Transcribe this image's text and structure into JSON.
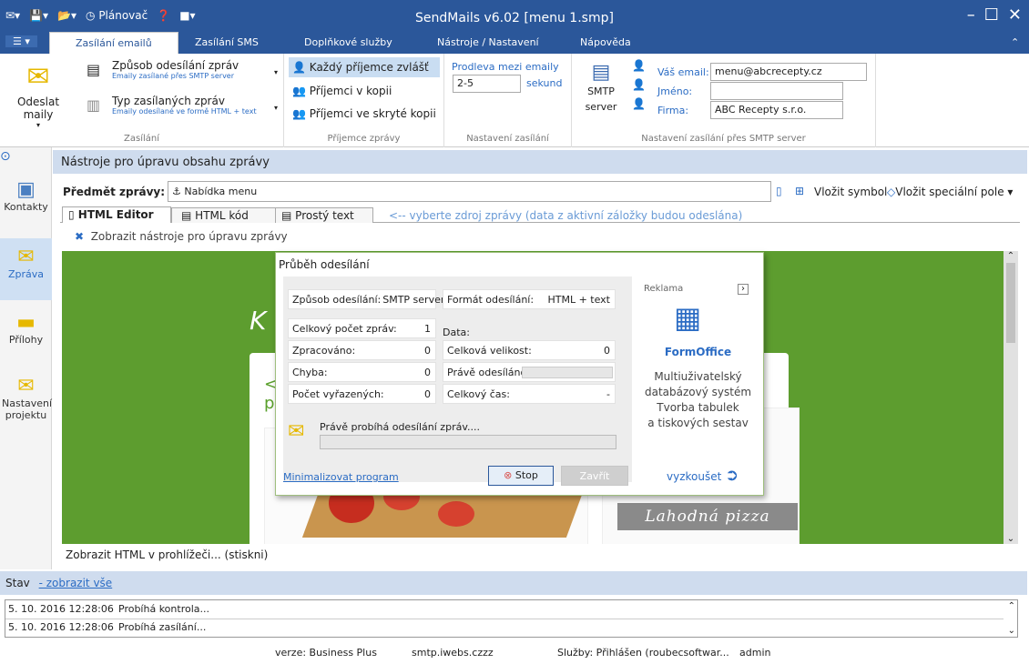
{
  "app": {
    "title": "SendMails v6.02 [menu 1.smp]",
    "qat_scheduler": "Plánovač"
  },
  "tabs": [
    "Zasílání emailů",
    "Zasílání SMS",
    "Doplňkové služby",
    "Nástroje / Nastavení",
    "Nápověda"
  ],
  "ribbon": {
    "send_label": "Odeslat maily",
    "method_label": "Způsob odesílání zpráv",
    "method_sub": "Emaily zasílané přes SMTP server",
    "type_label": "Typ zasílaných zpráv",
    "type_sub": "Emaily odesílané ve formě HTML + text",
    "group_zasilani": "Zasílání",
    "recip_each": "Každý příjemce zvlášť",
    "recip_cc": "Příjemci v kopii",
    "recip_bcc": "Příjemci ve skryté kopii",
    "group_recip": "Příjemce zprávy",
    "delay_label": "Prodleva mezi emaily",
    "delay_value": "2-5",
    "delay_unit": "sekund",
    "group_settings": "Nastavení zasílání",
    "smtp_label": "SMTP server",
    "your_email_label": "Váš email:",
    "your_email_value": "menu@abcrecepty.cz",
    "name_label": "Jméno:",
    "name_value": "",
    "company_label": "Firma:",
    "company_value": "ABC Recepty s.r.o.",
    "group_smtp": "Nastavení zasílání přes SMTP server"
  },
  "nav": [
    "Kontakty",
    "Zpráva",
    "Přílohy",
    "Nastavení projektu"
  ],
  "content": {
    "header": "Nástroje pro úpravu obsahu zprávy",
    "subject_label": "Předmět zprávy:",
    "subject_value": "Nabídka menu",
    "insert_symbol": "Vložit symbol",
    "insert_special": "Vložit speciální pole",
    "editor_tabs": [
      "HTML Editor",
      "HTML kód",
      "Prostý text"
    ],
    "source_hint": "<-- vyberte zdroj zprávy (data z aktivní záložky budou odeslána)",
    "show_tools": "Zobrazit nástroje pro úpravu zprávy",
    "preview_banner": "Lahodná pizza",
    "browser_hint": "Zobrazit HTML v prohlížeči... (stiskni)"
  },
  "dialog": {
    "title": "Průběh odesílání",
    "method_label": "Způsob odesílání:",
    "method_value": "SMTP server",
    "format_label": "Formát odesílání:",
    "format_value": "HTML + text",
    "total_label": "Celkový počet zpráv:",
    "total_value": "1",
    "data_label": "Data:",
    "processed_label": "Zpracováno:",
    "processed_value": "0",
    "size_label": "Celková velikost:",
    "size_value": "0",
    "error_label": "Chyba:",
    "error_value": "0",
    "now_sending_label": "Právě odesíláno:",
    "excluded_label": "Počet vyřazených:",
    "excluded_value": "0",
    "time_label": "Celkový čas:",
    "time_value": "-",
    "progress_text": "Právě probíhá odesílání zpráv....",
    "progress": 0,
    "minimize": "Minimalizovat program",
    "stop": "Stop",
    "close": "Zavřít",
    "ad_label": "Reklama",
    "ad_product": "FormOffice",
    "ad_line1": "Multiuživatelský",
    "ad_line2": "databázový systém",
    "ad_line3": "Tvorba tabulek",
    "ad_line4": "a tiskových sestav",
    "ad_try": "vyzkoušet"
  },
  "status": {
    "label": "Stav",
    "show_all": "- zobrazit vše",
    "log": [
      {
        "time": "5. 10. 2016 12:28:06",
        "msg": "Probíhá kontrola..."
      },
      {
        "time": "5. 10. 2016 12:28:06",
        "msg": "Probíhá zasílání..."
      }
    ],
    "version": "verze: Business Plus",
    "smtp": "smtp.iwebs.czzz",
    "services": "Služby: Přihlášen (roubecsoftwar...",
    "user": "admin"
  },
  "colors": {
    "accent": "#2b579a",
    "green": "#5aa02c",
    "link": "#2b6cc4"
  }
}
